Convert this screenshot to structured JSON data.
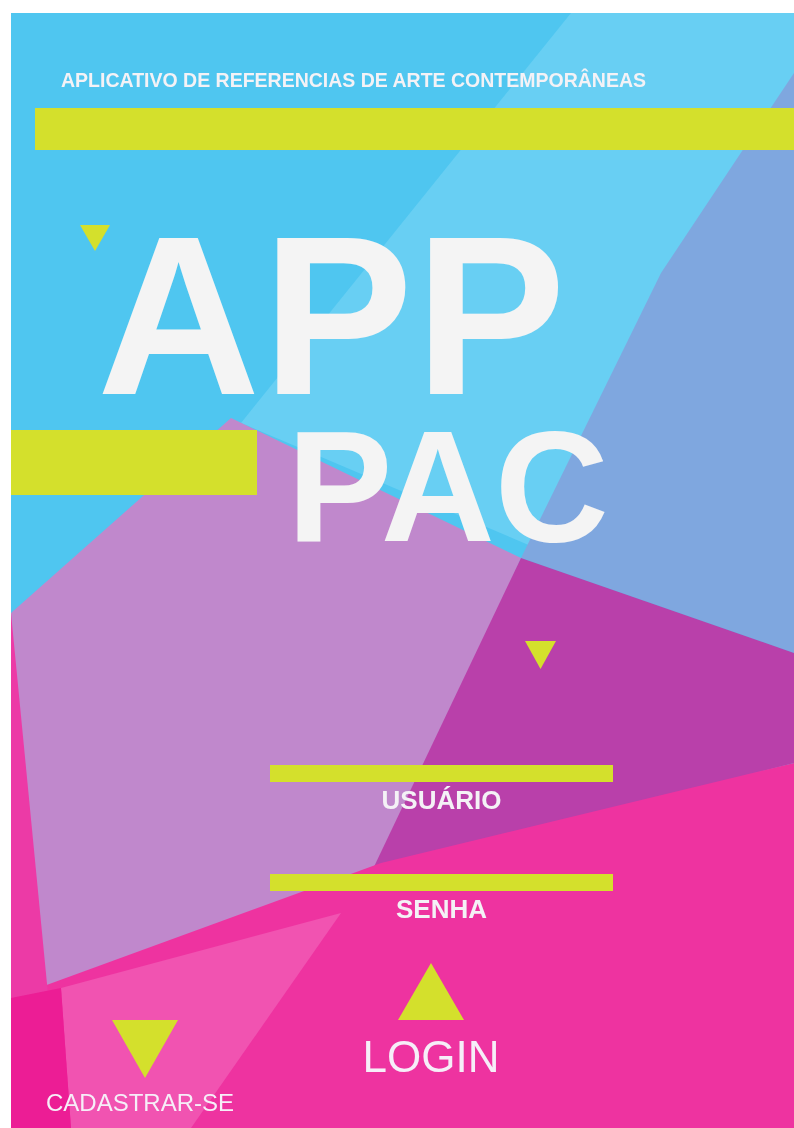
{
  "header": {
    "title": "APLICATIVO DE REFERENCIAS DE ARTE CONTEMPORÂNEAS"
  },
  "logo": [
    "APP",
    "PAC"
  ],
  "fields": [
    {
      "label": "USUÁRIO"
    },
    {
      "label": "SENHA"
    }
  ],
  "login_button": "LOGIN",
  "register_link": "CADASTRAR-SE"
}
